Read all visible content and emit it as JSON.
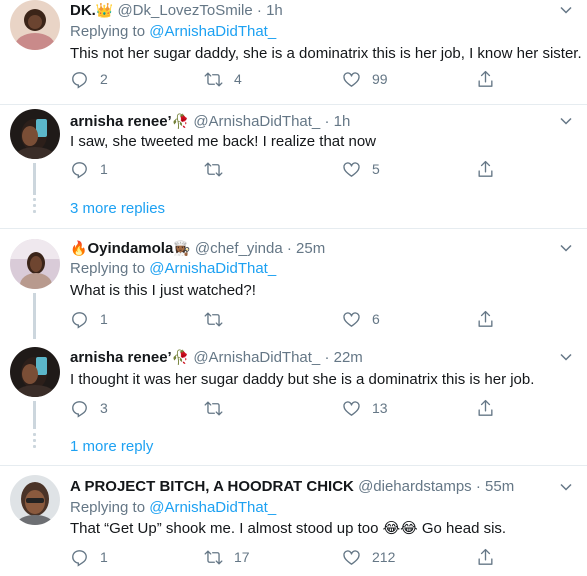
{
  "tweets": [
    {
      "name": "DK.",
      "name_emoji": "👑",
      "handle": "@Dk_LovezToSmile",
      "dot": "·",
      "time": "1h",
      "replying_prefix": "Replying to",
      "replying_handle": "@ArnishaDidThat_",
      "text": "This not her sugar daddy, she is a dominatrix this is her job, I know her sister.",
      "replies": "2",
      "retweets": "4",
      "likes": "99"
    },
    {
      "name": "arnisha renee’",
      "name_emoji": "🥀",
      "handle": "@ArnishaDidThat_",
      "dot": "·",
      "time": "1h",
      "text": "I saw, she tweeted me back! I realize that now",
      "replies": "1",
      "retweets": "",
      "likes": "5"
    },
    {
      "name": "Oyindamola",
      "name_emoji_before": "🔥",
      "name_emoji": "👩🏾‍🍳",
      "handle": "@chef_yinda",
      "dot": "·",
      "time": "25m",
      "replying_prefix": "Replying to",
      "replying_handle": "@ArnishaDidThat_",
      "text": "What is this I just watched?!",
      "replies": "1",
      "retweets": "",
      "likes": "6"
    },
    {
      "name": "arnisha renee’",
      "name_emoji": "🥀",
      "handle": "@ArnishaDidThat_",
      "dot": "·",
      "time": "22m",
      "text": "I thought it was her sugar daddy but she is a dominatrix this is her job.",
      "replies": "3",
      "retweets": "",
      "likes": "13"
    },
    {
      "name": "A PROJECT BITCH, A HOODRAT CHICK",
      "handle": "@diehardstamps",
      "dot": "·",
      "time": "55m",
      "replying_prefix": "Replying to",
      "replying_handle": "@ArnishaDidThat_",
      "text": "That “Get Up” shook me. I almost stood up too 😂😂 Go head sis.",
      "replies": "1",
      "retweets": "17",
      "likes": "212"
    }
  ],
  "more_replies": {
    "first": "3 more replies",
    "second": "1 more reply"
  },
  "colors": {
    "link_blue": "#1da1f2",
    "secondary_gray": "#657786",
    "divider": "#e6ecf0",
    "thread_line": "#ccd6dd"
  }
}
